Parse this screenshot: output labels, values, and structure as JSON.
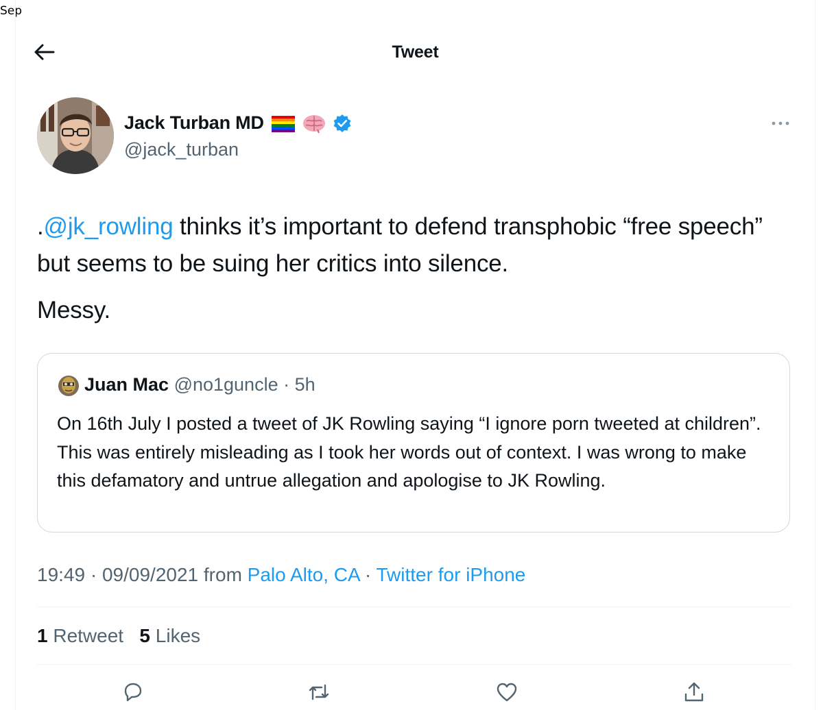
{
  "corner_label": "Sep",
  "header": {
    "title": "Tweet"
  },
  "tweet": {
    "author_name": "Jack Turban MD",
    "author_handle": "@jack_turban",
    "mention": "@jk_rowling",
    "text_prefix": ".",
    "text_after_mention": " thinks it’s important to defend transphobic “free speech” but seems to be suing her critics into silence.",
    "text_second": "Messy.",
    "time": "19:49",
    "sep1": " · ",
    "date": "09/09/2021",
    "from_label": " from ",
    "location": "Palo Alto, CA",
    "sep2": " · ",
    "client": "Twitter for iPhone"
  },
  "quote": {
    "name": "Juan Mac",
    "handle": "@no1guncle",
    "sep": " · ",
    "time": "5h",
    "text": "On 16th July I posted a tweet of JK Rowling saying “I ignore porn tweeted at children”. This was entirely misleading as I took her words out of context. I was wrong to make this defamatory and untrue allegation and apologise to JK Rowling."
  },
  "stats": {
    "retweets_count": "1",
    "retweets_label": " Retweet",
    "likes_count": "5",
    "likes_label": " Likes"
  },
  "icons": {
    "back": "arrow-left-icon",
    "verified": "verified-badge-icon",
    "more": "more-dots-icon",
    "reply": "reply-icon",
    "retweet": "retweet-icon",
    "like": "heart-icon",
    "share": "share-icon"
  },
  "colors": {
    "accent": "#1d9bf0",
    "secondary_text": "#536471",
    "primary_text": "#0f1419",
    "border": "#cfd9de"
  }
}
